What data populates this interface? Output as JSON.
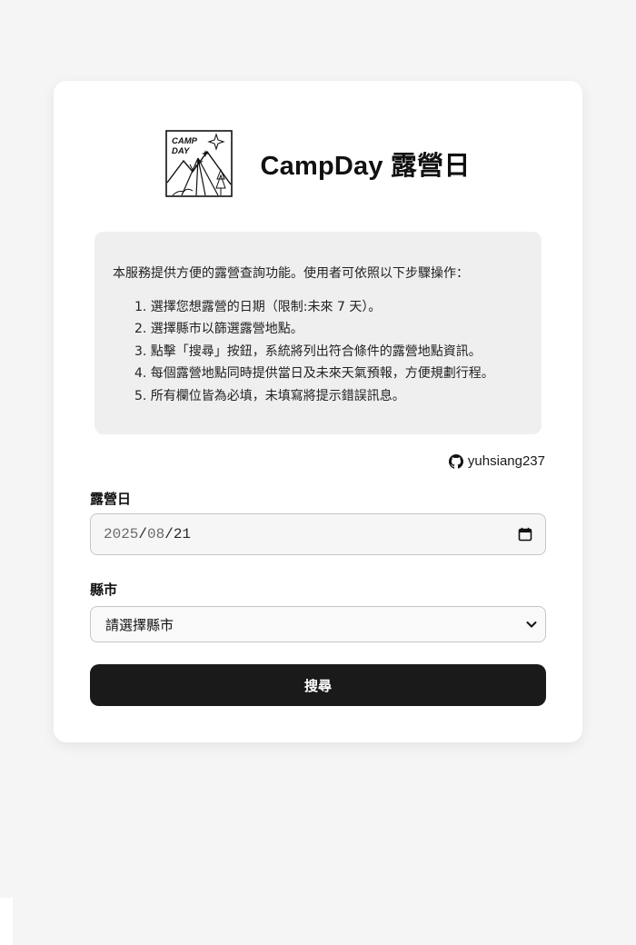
{
  "header": {
    "logo_text": "CAMP DAY",
    "title": "CampDay 露營日"
  },
  "info": {
    "intro": "本服務提供方便的露營查詢功能。使用者可依照以下步驟操作：",
    "steps": [
      "1. 選擇您想露營的日期（限制:未來 7 天）。",
      "2. 選擇縣市以篩選露營地點。",
      "3. 點擊「搜尋」按鈕，系統將列出符合條件的露營地點資訊。",
      "4. 每個露營地點同時提供當日及未來天氣預報，方便規劃行程。",
      "5. 所有欄位皆為必填，未填寫將提示錯誤訊息。"
    ]
  },
  "github": {
    "icon": "github-icon",
    "username": "yuhsiang237"
  },
  "form": {
    "date_label": "露營日",
    "date_year": "2025",
    "date_month": "08",
    "date_day": "21",
    "date_sep": "/",
    "city_label": "縣市",
    "city_placeholder": "請選擇縣市",
    "submit_label": "搜尋"
  },
  "colors": {
    "page_bg": "#f5f5f5",
    "card_bg": "#ffffff",
    "info_bg": "#efefef",
    "button_bg": "#1a1a1a",
    "button_text": "#ffffff"
  }
}
